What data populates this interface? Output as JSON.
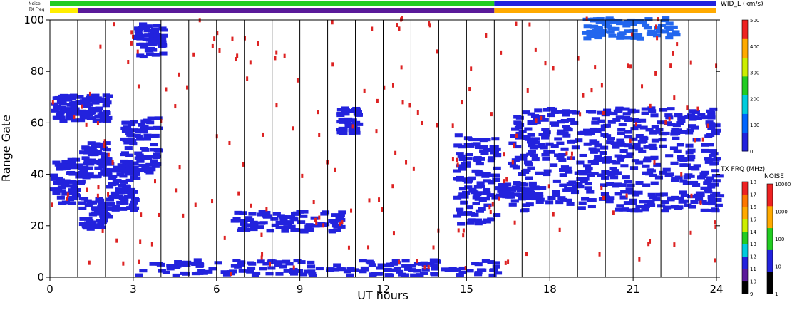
{
  "chart_data": {
    "type": "heatmap",
    "xlabel": "UT hours",
    "ylabel": "Range Gate",
    "xlim": [
      0,
      24
    ],
    "ylim": [
      0,
      100
    ],
    "x_ticks": [
      "0",
      "3",
      "6",
      "9",
      "12",
      "15",
      "18",
      "21",
      "24"
    ],
    "y_ticks": [
      "0",
      "20",
      "40",
      "60",
      "80",
      "100"
    ],
    "hour_lines": [
      1,
      2,
      3,
      4,
      5,
      6,
      7,
      8,
      9,
      10,
      11,
      12,
      13,
      14,
      15,
      16,
      17,
      18,
      19,
      20,
      21,
      22,
      23
    ],
    "noise_strip_label": "Noise",
    "txfreq_strip_label": "TX Freq",
    "noise_strip": [
      {
        "start": 0,
        "end": 16,
        "color": "#22cc22"
      },
      {
        "start": 16,
        "end": 24,
        "color": "#2222dd"
      }
    ],
    "txfreq_strip": [
      {
        "start": 0,
        "end": 1,
        "color": "#ffee00"
      },
      {
        "start": 1,
        "end": 16,
        "color": "#5a1a9a"
      },
      {
        "start": 16,
        "end": 24,
        "color": "#ffaa00"
      }
    ],
    "scatter_regions": [
      {
        "x": [
          0.0,
          1.0
        ],
        "y": [
          28,
          45
        ],
        "color": "#2222dd"
      },
      {
        "x": [
          0.0,
          1.0
        ],
        "y": [
          60,
          70
        ],
        "color": "#2222dd"
      },
      {
        "x": [
          1.0,
          2.0
        ],
        "y": [
          18,
          30
        ],
        "color": "#2222dd"
      },
      {
        "x": [
          1.0,
          2.0
        ],
        "y": [
          38,
          52
        ],
        "color": "#2222dd"
      },
      {
        "x": [
          1.0,
          2.0
        ],
        "y": [
          60,
          70
        ],
        "color": "#2222dd"
      },
      {
        "x": [
          2.0,
          3.0
        ],
        "y": [
          25,
          45
        ],
        "color": "#2222dd"
      },
      {
        "x": [
          2.5,
          3.8
        ],
        "y": [
          40,
          62
        ],
        "color": "#2222dd"
      },
      {
        "x": [
          3.0,
          4.0
        ],
        "y": [
          85,
          98
        ],
        "color": "#2222dd"
      },
      {
        "x": [
          6.5,
          10.5
        ],
        "y": [
          17,
          25
        ],
        "color": "#2222dd"
      },
      {
        "x": [
          10.3,
          11.0
        ],
        "y": [
          55,
          65
        ],
        "color": "#2222dd"
      },
      {
        "x": [
          3.0,
          16.0
        ],
        "y": [
          0,
          6
        ],
        "color": "#2222dd"
      },
      {
        "x": [
          14.5,
          16.0
        ],
        "y": [
          20,
          55
        ],
        "color": "#2222dd"
      },
      {
        "x": [
          16.0,
          17.5
        ],
        "y": [
          30,
          36
        ],
        "color": "#2222dd"
      },
      {
        "x": [
          16.5,
          24.0
        ],
        "y": [
          25,
          65
        ],
        "color": "#2222dd"
      },
      {
        "x": [
          19.0,
          22.5
        ],
        "y": [
          92,
          100
        ],
        "color": "#2266ee"
      },
      {
        "x": [
          0.0,
          24.0
        ],
        "y": [
          0,
          100
        ],
        "color": "#dd2222"
      }
    ]
  },
  "colorbars": {
    "width": {
      "title": "WID_L (km/s)",
      "ticks": [
        "0",
        "100",
        "200",
        "300",
        "400",
        "500"
      ],
      "colors": [
        "#2222dd",
        "#0066ff",
        "#00ccdd",
        "#22cc22",
        "#ccee00",
        "#ffaa00",
        "#ee2222"
      ]
    },
    "txfreq": {
      "title": "TX FRQ (MHz)",
      "ticks": [
        "9",
        "10",
        "11",
        "12",
        "13",
        "14",
        "15",
        "16",
        "17",
        "18"
      ],
      "colors": [
        "#000000",
        "#5a1a9a",
        "#2222dd",
        "#00ccdd",
        "#22cc22",
        "#ccee00",
        "#ffaa00",
        "#ff7700",
        "#ee2222"
      ]
    },
    "noise": {
      "title": "NOISE",
      "ticks": [
        "1",
        "10",
        "100",
        "1000",
        "10000"
      ],
      "colors": [
        "#000000",
        "#2222dd",
        "#22cc22",
        "#ffaa00",
        "#ee2222"
      ]
    }
  }
}
